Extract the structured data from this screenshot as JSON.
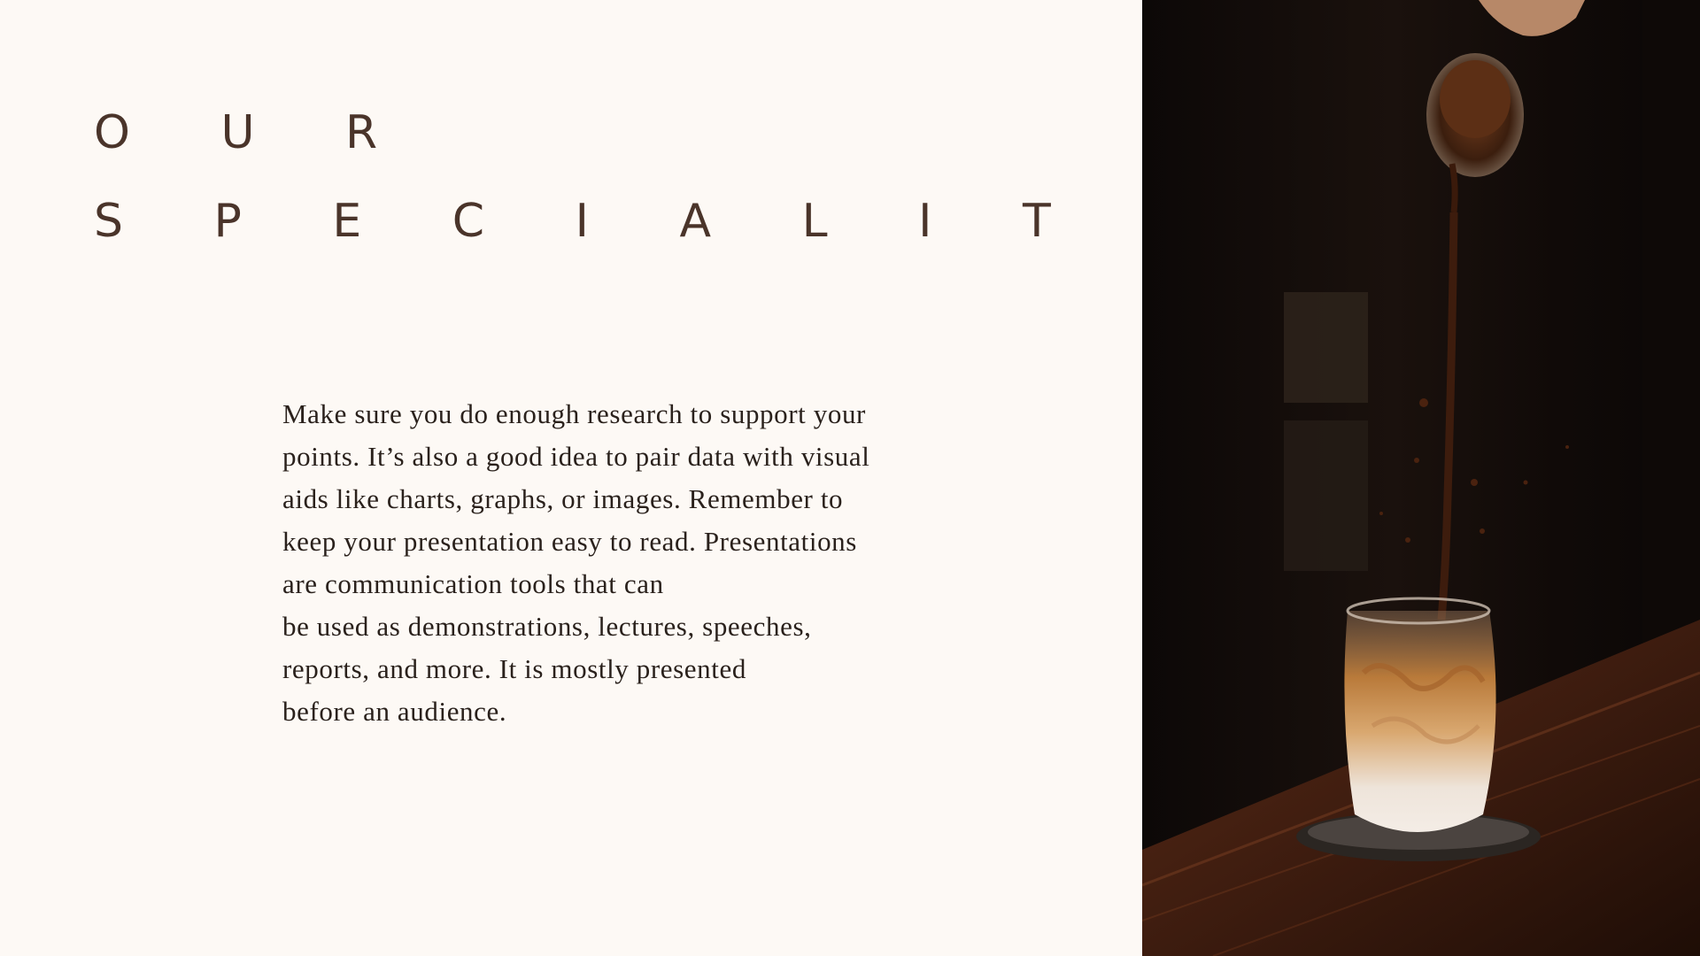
{
  "slide": {
    "title_line1": "O U R",
    "title_line2": "S P E C I A L I T I E S",
    "body": "Make sure you do enough research to support your\npoints. It’s also a good idea to pair data with visual\naids like charts, graphs, or images. Remember to\nkeep your presentation easy to read. Presentations\nare communication tools that can\n be used as demonstrations, lectures, speeches,\nreports, and more. It is mostly presented\nbefore an audience."
  },
  "colors": {
    "background": "#fdf9f5",
    "title": "#4a342a",
    "body": "#2a211c"
  },
  "image": {
    "subject": "coffee-pour-photo"
  }
}
